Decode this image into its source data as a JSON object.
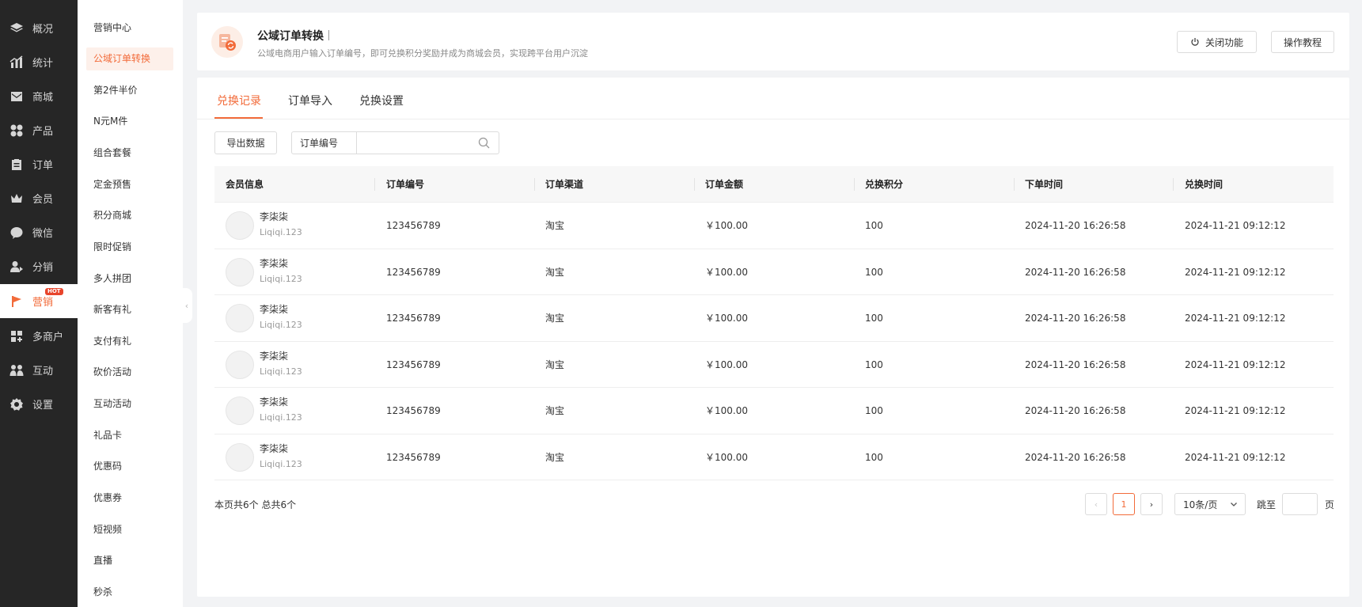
{
  "nav": {
    "items": [
      {
        "label": "概况",
        "icon": "layers-icon"
      },
      {
        "label": "统计",
        "icon": "chart-icon"
      },
      {
        "label": "商城",
        "icon": "mail-icon"
      },
      {
        "label": "产品",
        "icon": "grid-icon"
      },
      {
        "label": "订单",
        "icon": "clipboard-icon"
      },
      {
        "label": "会员",
        "icon": "crown-icon"
      },
      {
        "label": "微信",
        "icon": "wechat-icon"
      },
      {
        "label": "分销",
        "icon": "users-icon"
      },
      {
        "label": "营销",
        "icon": "flag-icon",
        "badge": "HOT"
      },
      {
        "label": "多商户",
        "icon": "store-icon"
      },
      {
        "label": "互动",
        "icon": "people-icon"
      },
      {
        "label": "设置",
        "icon": "gear-icon"
      }
    ],
    "active_index": 8
  },
  "subnav": {
    "items": [
      "营销中心",
      "公域订单转换",
      "第2件半价",
      "N元M件",
      "组合套餐",
      "定金预售",
      "积分商城",
      "限时促销",
      "多人拼团",
      "新客有礼",
      "支付有礼",
      "砍价活动",
      "互动活动",
      "礼品卡",
      "优惠码",
      "优惠券",
      "短视频",
      "直播",
      "秒杀"
    ],
    "active_index": 1
  },
  "header": {
    "title": "公域订单转换",
    "description": "公域电商用户输入订单编号，即可兑换积分奖励并成为商城会员，实现跨平台用户沉淀",
    "close_button": "关闭功能",
    "tutorial_button": "操作教程"
  },
  "tabs": [
    "兑换记录",
    "订单导入",
    "兑换设置"
  ],
  "active_tab": 0,
  "toolbar": {
    "export_button": "导出数据",
    "search_label": "订单编号",
    "search_value": "",
    "search_placeholder": ""
  },
  "table": {
    "columns": [
      "会员信息",
      "订单编号",
      "订单渠道",
      "订单金额",
      "兑换积分",
      "下单时间",
      "兑换时间"
    ],
    "rows": [
      {
        "name": "李柒柒",
        "member_id": "Liqiqi.123",
        "order_no": "123456789",
        "channel": "淘宝",
        "amount": "￥100.00",
        "points": "100",
        "order_time": "2024-11-20 16:26:58",
        "redeem_time": "2024-11-21  09:12:12"
      },
      {
        "name": "李柒柒",
        "member_id": "Liqiqi.123",
        "order_no": "123456789",
        "channel": "淘宝",
        "amount": "￥100.00",
        "points": "100",
        "order_time": "2024-11-20 16:26:58",
        "redeem_time": "2024-11-21  09:12:12"
      },
      {
        "name": "李柒柒",
        "member_id": "Liqiqi.123",
        "order_no": "123456789",
        "channel": "淘宝",
        "amount": "￥100.00",
        "points": "100",
        "order_time": "2024-11-20 16:26:58",
        "redeem_time": "2024-11-21  09:12:12"
      },
      {
        "name": "李柒柒",
        "member_id": "Liqiqi.123",
        "order_no": "123456789",
        "channel": "淘宝",
        "amount": "￥100.00",
        "points": "100",
        "order_time": "2024-11-20 16:26:58",
        "redeem_time": "2024-11-21  09:12:12"
      },
      {
        "name": "李柒柒",
        "member_id": "Liqiqi.123",
        "order_no": "123456789",
        "channel": "淘宝",
        "amount": "￥100.00",
        "points": "100",
        "order_time": "2024-11-20 16:26:58",
        "redeem_time": "2024-11-21  09:12:12"
      },
      {
        "name": "李柒柒",
        "member_id": "Liqiqi.123",
        "order_no": "123456789",
        "channel": "淘宝",
        "amount": "￥100.00",
        "points": "100",
        "order_time": "2024-11-20 16:26:58",
        "redeem_time": "2024-11-21  09:12:12"
      }
    ]
  },
  "pagination": {
    "summary": "本页共6个  总共6个",
    "current_page": "1",
    "page_size": "10条/页",
    "jump_label": "跳至",
    "jump_unit": "页"
  },
  "colors": {
    "accent": "#f26b3a",
    "nav_bg": "#262626",
    "page_bg": "#f2f3f5"
  }
}
